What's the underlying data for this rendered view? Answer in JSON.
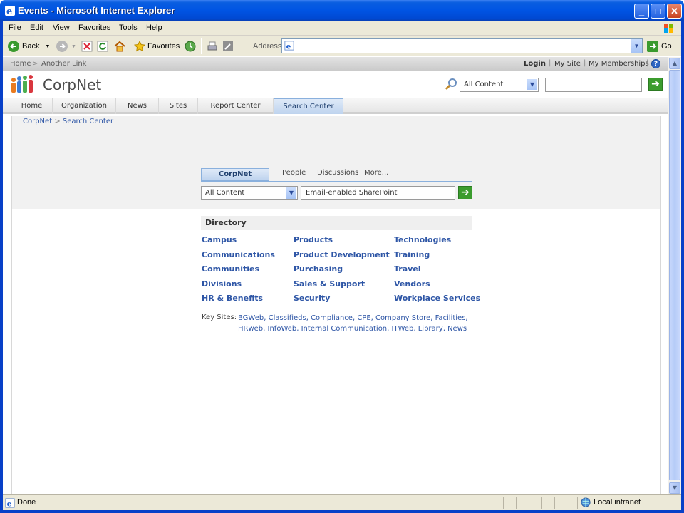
{
  "window": {
    "title": "Events - Microsoft Internet Explorer",
    "minimize": "_",
    "maximize": "□",
    "close": "✕"
  },
  "menu": [
    "File",
    "Edit",
    "View",
    "Favorites",
    "Tools",
    "Help"
  ],
  "toolbar": {
    "back_label": "Back",
    "favorites_label": "Favorites",
    "address_label": "Address",
    "address_value": "",
    "go_label": "Go"
  },
  "topstrip": {
    "breadcrumb_home": "Home",
    "breadcrumb_sep": ">",
    "breadcrumb_link": "Another Link",
    "login": "Login",
    "my_site": "My Site",
    "my_memberships": "My Memberships",
    "help": "?"
  },
  "header": {
    "site_title": "CorpNet",
    "scope_value": "All Content",
    "query_value": ""
  },
  "tabs": [
    "Home",
    "Organization",
    "News",
    "Sites",
    "Report Center",
    "Search Center"
  ],
  "active_tab": "Search Center",
  "crumb": {
    "root": "CorpNet",
    "sep": ">",
    "current": "Search Center"
  },
  "search": {
    "tabs": [
      "CorpNet",
      "People",
      "Discussions",
      "More..."
    ],
    "scope_value": "All Content",
    "query_value": "Email-enabled SharePoint"
  },
  "directory": {
    "header": "Directory",
    "col1": [
      "Campus",
      "Communications",
      "Communities",
      "Divisions",
      "HR & Benefits"
    ],
    "col2": [
      "Products",
      "Product Development",
      "Purchasing",
      "Sales & Support",
      "Security"
    ],
    "col3": [
      "Technologies",
      "Training",
      "Travel",
      "Vendors",
      "Workplace Services"
    ]
  },
  "key_sites": {
    "label": "Key Sites:",
    "links": [
      "BGWeb",
      "Classifieds",
      "Compliance",
      "CPE",
      "Company Store",
      "Facilities",
      "HRweb",
      "InfoWeb",
      "Internal Communication",
      "ITWeb",
      "Library",
      "News"
    ]
  },
  "status": {
    "text": "Done",
    "zone": "Local intranet"
  }
}
